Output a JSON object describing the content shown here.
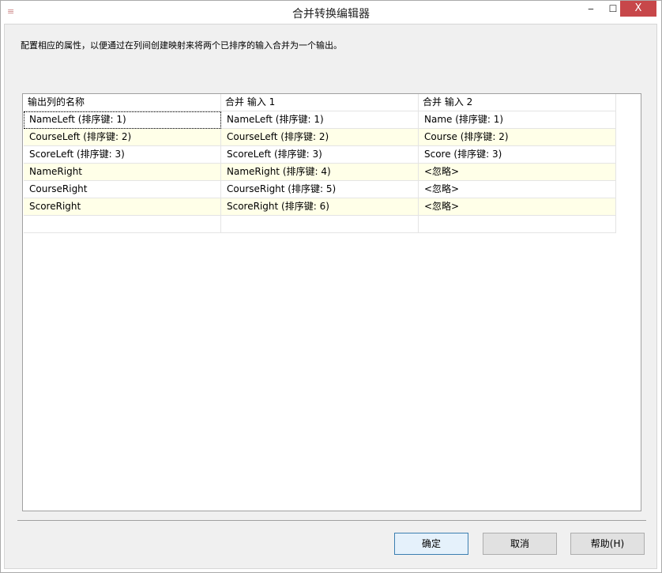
{
  "window": {
    "title": "合并转换编辑器",
    "minimize": "‒",
    "maximize": "☐",
    "close": "X"
  },
  "description": "配置相应的属性，以便通过在列间创建映射来将两个已排序的输入合并为一个输出。",
  "grid": {
    "headers": [
      "输出列的名称",
      "合并 输入 1",
      "合并 输入 2"
    ],
    "rows": [
      [
        "NameLeft (排序键: 1)",
        "NameLeft (排序键: 1)",
        "Name (排序键: 1)"
      ],
      [
        "CourseLeft (排序键: 2)",
        "CourseLeft (排序键: 2)",
        "Course (排序键: 2)"
      ],
      [
        "ScoreLeft (排序键: 3)",
        "ScoreLeft (排序键: 3)",
        "Score (排序键: 3)"
      ],
      [
        "NameRight",
        "NameRight (排序键: 4)",
        "<忽略>"
      ],
      [
        "CourseRight",
        "CourseRight (排序键: 5)",
        "<忽略>"
      ],
      [
        "ScoreRight",
        "ScoreRight (排序键: 6)",
        "<忽略>"
      ],
      [
        "",
        "",
        ""
      ]
    ]
  },
  "buttons": {
    "ok": "确定",
    "cancel": "取消",
    "help": "帮助(H)"
  }
}
